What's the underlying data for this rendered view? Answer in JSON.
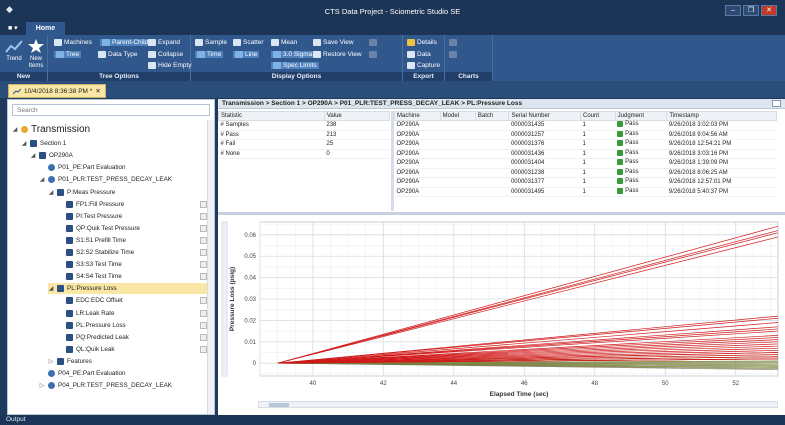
{
  "window": {
    "title": "CTS Data Project - Sciometric Studio SE",
    "controls": [
      "–",
      "❐",
      "✕"
    ]
  },
  "menu": {
    "file": "■ ▾",
    "home_tab": "Home"
  },
  "ribbon": {
    "new_group": {
      "label": "New",
      "trend": "Trend",
      "new_items": "New Items"
    },
    "tree_group": {
      "label": "Tree Options",
      "machines": "Machines",
      "parent_child": "Parent-Child",
      "expand": "Expand",
      "tree": "Tree",
      "data_type": "Data Type",
      "collapse": "Collapse",
      "hide_empty": "Hide Empty"
    },
    "display_group": {
      "label": "Display Options",
      "sample": "Sample",
      "scatter": "Scatter",
      "mean": "Mean",
      "save_view": "Save View",
      "time": "Time",
      "line": "Line",
      "sigma3": "3.0 Sigma",
      "restore_view": "Restore View",
      "spec_limits": "Spec Limits"
    },
    "export_group": {
      "label": "Export",
      "details": "Details",
      "data": "Data",
      "capture": "Capture"
    },
    "charts_group": {
      "label": "Charts"
    }
  },
  "doc_tab": {
    "label": "10/4/2018 8:36:38 PM *",
    "close": "✕"
  },
  "search": {
    "placeholder": "Search"
  },
  "tree": [
    {
      "label": "Transmission",
      "level": 0,
      "icon": "gold",
      "ex": "◢",
      "big": true
    },
    {
      "label": "Section 1",
      "level": 1,
      "icon": "sq",
      "ex": "◢"
    },
    {
      "label": "OP290A",
      "level": 2,
      "icon": "sq",
      "ex": "◢"
    },
    {
      "label": "P01_PE:Part Evaluation",
      "level": 3,
      "icon": "gear",
      "ex": ""
    },
    {
      "label": "P01_PLR:TEST_PRESS_DECAY_LEAK",
      "level": 3,
      "icon": "gear",
      "ex": "◢"
    },
    {
      "label": "P:Meas Pressure",
      "level": 4,
      "icon": "sq",
      "ex": "◢"
    },
    {
      "label": "FP1:Fill Pressure",
      "level": 5,
      "icon": "sq",
      "ex": "",
      "cb": true
    },
    {
      "label": "PI:Test Pressure",
      "level": 5,
      "icon": "sq",
      "ex": "",
      "cb": true
    },
    {
      "label": "QP:Quik Test Pressure",
      "level": 5,
      "icon": "sq",
      "ex": "",
      "cb": true
    },
    {
      "label": "S1:S1 Prefill Time",
      "level": 5,
      "icon": "sq",
      "ex": "",
      "cb": true
    },
    {
      "label": "S2:S2 Stabilize Time",
      "level": 5,
      "icon": "sq",
      "ex": "",
      "cb": true
    },
    {
      "label": "S3:S3 Test Time",
      "level": 5,
      "icon": "sq",
      "ex": "",
      "cb": true
    },
    {
      "label": "S4:S4 Test Time",
      "level": 5,
      "icon": "sq",
      "ex": "",
      "cb": true
    },
    {
      "label": "PL:Pressure Loss",
      "level": 4,
      "icon": "sq",
      "ex": "◢",
      "sel": true
    },
    {
      "label": "EDC:EDC Offset",
      "level": 5,
      "icon": "sq",
      "ex": "",
      "cb": true
    },
    {
      "label": "LR:Leak Rate",
      "level": 5,
      "icon": "sq",
      "ex": "",
      "cb": true
    },
    {
      "label": "PL:Pressure Loss",
      "level": 5,
      "icon": "sq",
      "ex": "",
      "cb": true
    },
    {
      "label": "PQ:Predicted Leak",
      "level": 5,
      "icon": "sq",
      "ex": "",
      "cb": true
    },
    {
      "label": "QL:Quik Leak",
      "level": 5,
      "icon": "sq",
      "ex": "",
      "cb": true
    },
    {
      "label": "Features",
      "level": 4,
      "icon": "sq",
      "ex": "▷"
    },
    {
      "label": "P04_PE:Part Evaluation",
      "level": 3,
      "icon": "gear",
      "ex": ""
    },
    {
      "label": "P04_PLR:TEST_PRESS_DECAY_LEAK",
      "level": 3,
      "icon": "gear",
      "ex": "▷"
    }
  ],
  "breadcrumb": "Transmission > Section 1 > OP290A > P01_PLR:TEST_PRESS_DECAY_LEAK > PL:Pressure Loss",
  "stats": {
    "headers": [
      "Statistic",
      "Value"
    ],
    "rows": [
      [
        "# Samples",
        "238"
      ],
      [
        "# Pass",
        "213"
      ],
      [
        "# Fail",
        "25"
      ],
      [
        "# None",
        "0"
      ]
    ]
  },
  "machines": {
    "headers": [
      "Machine",
      "Model",
      "Batch",
      "Serial Number",
      "Count",
      "Judgment",
      "Timestamp"
    ],
    "rows": [
      [
        "OP290A",
        "",
        "",
        "0000031435",
        "1",
        "Pass",
        "9/26/2018 3:02:03 PM"
      ],
      [
        "OP290A",
        "",
        "",
        "0000031257",
        "1",
        "Pass",
        "9/26/2018 9:04:56 AM"
      ],
      [
        "OP290A",
        "",
        "",
        "0000031376",
        "1",
        "Pass",
        "9/26/2018 12:54:21 PM"
      ],
      [
        "OP290A",
        "",
        "",
        "0000031436",
        "1",
        "Pass",
        "9/26/2018 3:03:16 PM"
      ],
      [
        "OP290A",
        "",
        "",
        "0000031404",
        "1",
        "Pass",
        "9/26/2018 1:39:09 PM"
      ],
      [
        "OP290A",
        "",
        "",
        "0000031238",
        "1",
        "Pass",
        "9/26/2018 8:06:25 AM"
      ],
      [
        "OP290A",
        "",
        "",
        "0000031377",
        "1",
        "Pass",
        "9/26/2018 12:57:01 PM"
      ],
      [
        "OP290A",
        "",
        "",
        "0000031495",
        "1",
        "Pass",
        "9/26/2018 5:40:37 PM"
      ]
    ]
  },
  "chart_data": {
    "type": "line",
    "title": "",
    "xlabel": "Elapsed Time (sec)",
    "ylabel": "Pressure Loss (psig)",
    "xlim": [
      38.5,
      53.2
    ],
    "ylim": [
      -0.006,
      0.066
    ],
    "xticks": [
      40,
      42,
      44,
      46,
      48,
      50,
      52
    ],
    "yticks": [
      0,
      0.01,
      0.02,
      0.03,
      0.04,
      0.05,
      0.06
    ],
    "x_start": 39.0,
    "x_end": 53.2,
    "fail_end_values": [
      0.064,
      0.062,
      0.061,
      0.059,
      0.022,
      0.021,
      0.019,
      0.017,
      0.016,
      0.015,
      0.013,
      0.012,
      0.011,
      0.01,
      0.009,
      0.008,
      0.007,
      0.006,
      0.005,
      0.005,
      0.004,
      0.003,
      0.003,
      0.002,
      0.002
    ],
    "pass_end_values": [
      0.004,
      0.003,
      0.003,
      0.002,
      0.002,
      0.001,
      0.001,
      0.0005,
      0,
      0,
      -0.0005,
      -0.001,
      -0.001,
      -0.0015,
      -0.002,
      -0.002,
      -0.0025,
      -0.003
    ],
    "colors": {
      "fail": "#d11a1a",
      "pass": "#6d6f42",
      "pass_alt": "#8a9a3a"
    }
  },
  "status": {
    "output": "Output"
  }
}
